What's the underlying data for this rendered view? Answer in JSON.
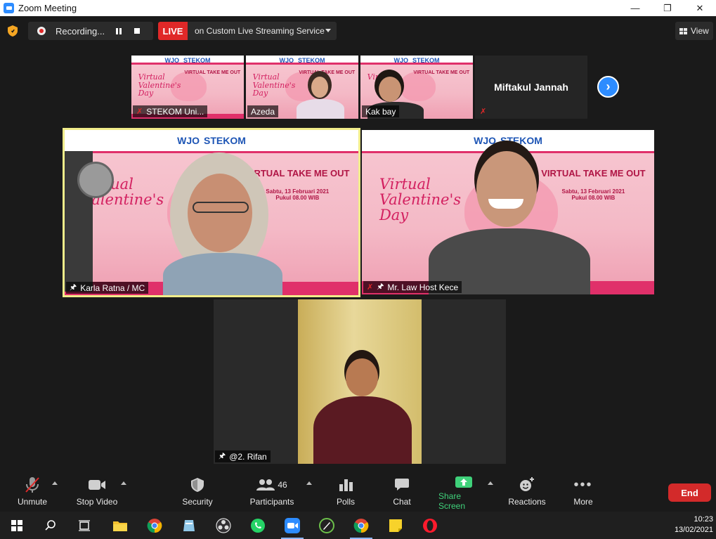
{
  "window": {
    "title": "Zoom Meeting"
  },
  "topbar": {
    "recording_label": "Recording...",
    "live_tag": "LIVE",
    "live_service": "on Custom Live Streaming Service",
    "view_label": "View"
  },
  "strip": {
    "tiles": [
      {
        "name": "STEKOM Uni...",
        "muted": true
      },
      {
        "name": "Azeda",
        "muted": false
      },
      {
        "name": "Kak bay",
        "muted": false
      },
      {
        "name": "Miftakul Jannah",
        "muted": true
      }
    ]
  },
  "slide": {
    "logo_main": "WJO",
    "logo_univ": "STEKOM",
    "title_line1": "Virtual",
    "title_line2": "Valentine's",
    "title_line3": "Day",
    "event": "VIRTUAL TAKE ME OUT",
    "date": "Sabtu, 13 Februari 2021",
    "time": "Pukul 08.00 WIB"
  },
  "main": {
    "left_name": "Karla Ratna / MC",
    "right_name": "Mr. Law Host Kece",
    "bottom_name": "@2. Rifan"
  },
  "controls": {
    "unmute": "Unmute",
    "stop_video": "Stop Video",
    "security": "Security",
    "participants": "Participants",
    "participants_count": "46",
    "polls": "Polls",
    "chat": "Chat",
    "share_screen": "Share Screen",
    "reactions": "Reactions",
    "more": "More",
    "end": "End"
  },
  "taskbar": {
    "time": "10:23",
    "date": "13/02/2021"
  },
  "colors": {
    "zoom_blue": "#2d8cff",
    "live_red": "#e02828",
    "share_green": "#3fd17a",
    "end_red": "#d32a2a",
    "active_speaker_border": "#f0ec8a"
  }
}
